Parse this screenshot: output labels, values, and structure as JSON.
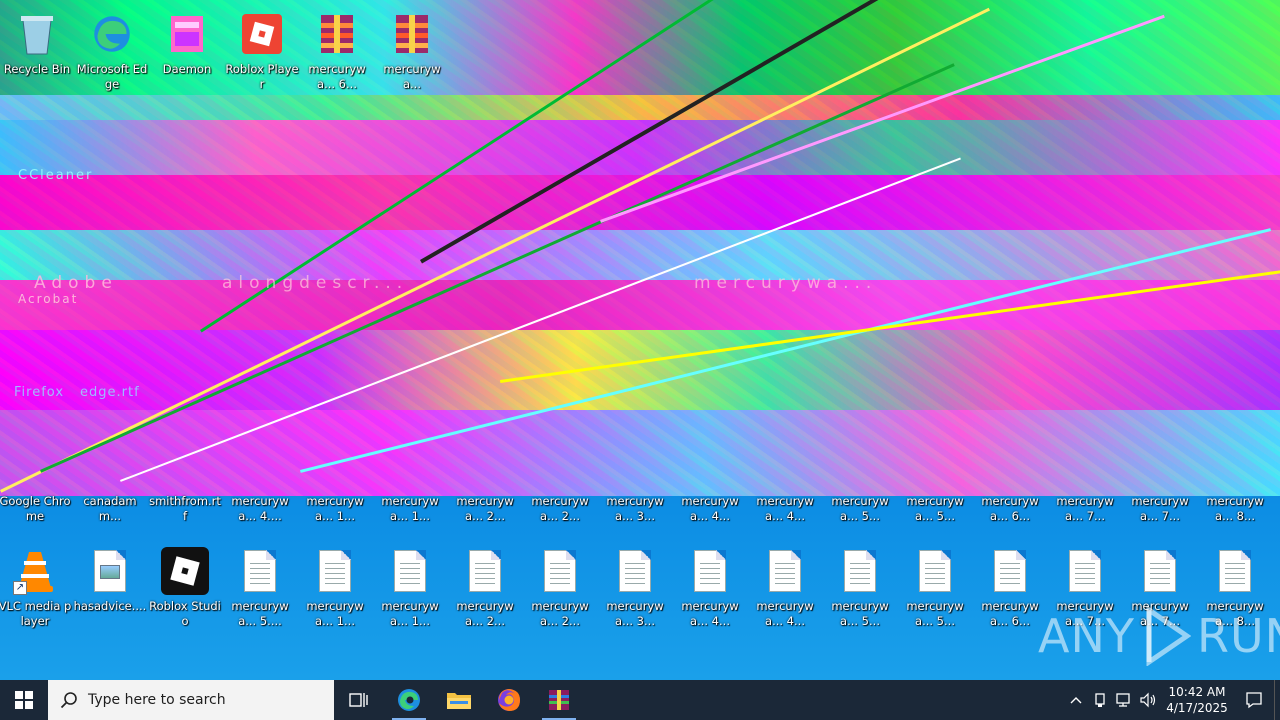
{
  "desktop": {
    "row_top": [
      {
        "label": "Recycle Bin",
        "kind": "bin"
      },
      {
        "label": "Microsoft Edge",
        "kind": "edge"
      },
      {
        "label": "Daemon",
        "kind": "pink"
      },
      {
        "label": "Roblox Player",
        "kind": "roblox-red"
      },
      {
        "label": "mercurywa... 6...",
        "kind": "rar"
      },
      {
        "label": "mercurywa...",
        "kind": "rar"
      }
    ],
    "row_a": [
      {
        "label": "Google Chrome"
      },
      {
        "label": "canadamm..."
      },
      {
        "label": "smithfrom.rtf"
      },
      {
        "label": "mercurywa... 4...."
      },
      {
        "label": "mercurywa... 1..."
      },
      {
        "label": "mercurywa... 1..."
      },
      {
        "label": "mercurywa... 2..."
      },
      {
        "label": "mercurywa... 2..."
      },
      {
        "label": "mercurywa... 3..."
      },
      {
        "label": "mercurywa... 4..."
      },
      {
        "label": "mercurywa... 4..."
      },
      {
        "label": "mercurywa... 5..."
      },
      {
        "label": "mercurywa... 5..."
      },
      {
        "label": "mercurywa... 6..."
      },
      {
        "label": "mercurywa... 7..."
      },
      {
        "label": "mercurywa... 7..."
      },
      {
        "label": "mercurywa... 8..."
      }
    ],
    "row_b": [
      {
        "label": "VLC media player",
        "kind": "vlc"
      },
      {
        "label": "hasadvice....",
        "kind": "img"
      },
      {
        "label": "Roblox Studio",
        "kind": "roblox"
      },
      {
        "label": "mercurywa... 5....",
        "kind": "doc"
      },
      {
        "label": "mercurywa... 1...",
        "kind": "doc"
      },
      {
        "label": "mercurywa... 1...",
        "kind": "doc"
      },
      {
        "label": "mercurywa... 2...",
        "kind": "doc"
      },
      {
        "label": "mercurywa... 2...",
        "kind": "doc"
      },
      {
        "label": "mercurywa... 3...",
        "kind": "doc"
      },
      {
        "label": "mercurywa... 4...",
        "kind": "doc"
      },
      {
        "label": "mercurywa... 4...",
        "kind": "doc"
      },
      {
        "label": "mercurywa... 5...",
        "kind": "doc"
      },
      {
        "label": "mercurywa... 5...",
        "kind": "doc"
      },
      {
        "label": "mercurywa... 6...",
        "kind": "doc"
      },
      {
        "label": "mercurywa... 7...",
        "kind": "doc"
      },
      {
        "label": "mercurywa... 7...",
        "kind": "doc"
      },
      {
        "label": "mercurywa... 8...",
        "kind": "doc"
      }
    ]
  },
  "glitch_text": {
    "ccleaner": "CCleaner",
    "adobe": "Adobe",
    "acrobat": "Acrobat",
    "alongdesc": "alongdescr...",
    "mercury": "mercurywa...",
    "firefox": "Firefox",
    "edge_rtf": "edge.rtf"
  },
  "watermark": {
    "left": "ANY",
    "right": "RUN"
  },
  "taskbar": {
    "search_placeholder": "Type here to search",
    "apps": [
      "task-view",
      "edge",
      "file-explorer",
      "firefox",
      "winrar"
    ],
    "time": "10:42 AM",
    "date": "4/17/2025"
  },
  "colors": {
    "taskbar": "#1b2838",
    "wallpaper": "#0b78d0",
    "accent": "#7fb2f0"
  }
}
